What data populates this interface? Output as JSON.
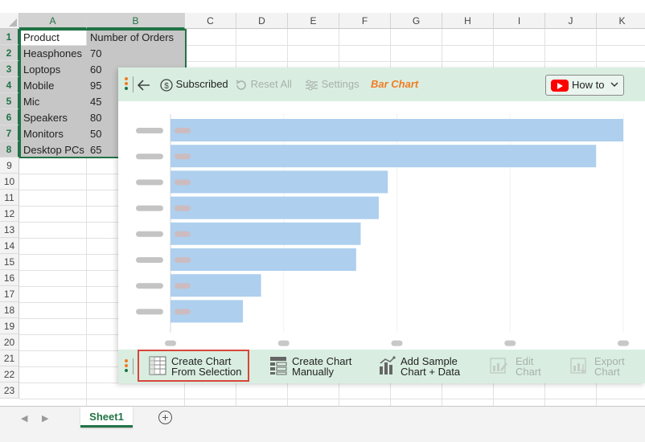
{
  "sheet": {
    "columns": [
      "A",
      "B",
      "C",
      "D",
      "E",
      "F",
      "G",
      "H",
      "I",
      "J",
      "K"
    ],
    "selected_columns": [
      "A",
      "B"
    ],
    "rows": [
      "1",
      "2",
      "3",
      "4",
      "5",
      "6",
      "7",
      "8",
      "9",
      "10",
      "11",
      "12",
      "13",
      "14",
      "15",
      "16",
      "17",
      "18",
      "19",
      "20",
      "21",
      "22",
      "23"
    ],
    "selected_rows": [
      "1",
      "2",
      "3",
      "4",
      "5",
      "6",
      "7",
      "8"
    ],
    "header": {
      "a": "Product",
      "b": "Number of Orders"
    },
    "data": [
      {
        "product": "Heasphones",
        "orders": "70"
      },
      {
        "product": "Loptops",
        "orders": "60"
      },
      {
        "product": "Mobile",
        "orders": "95"
      },
      {
        "product": "Mic",
        "orders": "45"
      },
      {
        "product": "Speakers",
        "orders": "80"
      },
      {
        "product": "Monitors",
        "orders": "50"
      },
      {
        "product": "Desktop PCs",
        "orders": "65"
      }
    ],
    "tab_name": "Sheet1",
    "selection_color": "#217346"
  },
  "panel": {
    "top_toolbar": {
      "subscribed_label": "Subscribed",
      "reset_label": "Reset All",
      "settings_label": "Settings",
      "chart_type_label": "Bar Chart",
      "howto_label": "How to"
    },
    "bottom_toolbar": {
      "create_from_selection": [
        "Create Chart",
        "From Selection"
      ],
      "create_manually": [
        "Create Chart",
        "Manually"
      ],
      "add_sample": [
        "Add Sample",
        "Chart + Data"
      ],
      "edit_chart": [
        "Edit",
        "Chart"
      ],
      "export_chart": [
        "Export",
        "Chart"
      ]
    },
    "accent_color": "#f07c23",
    "toolbar_color": "#d9eee1"
  },
  "chart_data": {
    "type": "bar",
    "orientation": "horizontal",
    "placeholder": true,
    "values": [
      100,
      94,
      48,
      46,
      42,
      41,
      20,
      16
    ],
    "x_ticks": 5,
    "xlim": [
      0,
      100
    ],
    "bar_color": "#aecfee",
    "grid": true
  }
}
